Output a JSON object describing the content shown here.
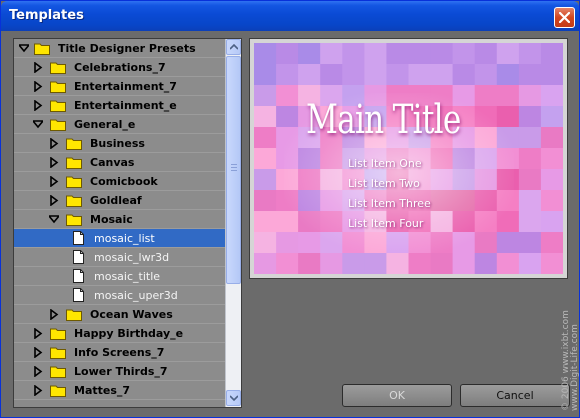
{
  "window": {
    "title": "Templates"
  },
  "colors": {
    "titlebar": "#0846c8",
    "selection": "#316ac5",
    "panel": "#6b6b6b"
  },
  "tree": {
    "rows": [
      {
        "label": "Title Designer Presets",
        "level": 0,
        "type": "folder",
        "expanded": true
      },
      {
        "label": "Celebrations_7",
        "level": 1,
        "type": "folder",
        "expanded": false
      },
      {
        "label": "Entertainment_7",
        "level": 1,
        "type": "folder",
        "expanded": false
      },
      {
        "label": "Entertainment_e",
        "level": 1,
        "type": "folder",
        "expanded": false
      },
      {
        "label": "General_e",
        "level": 1,
        "type": "folder",
        "expanded": true
      },
      {
        "label": "Business",
        "level": 2,
        "type": "folder",
        "expanded": false
      },
      {
        "label": "Canvas",
        "level": 2,
        "type": "folder",
        "expanded": false
      },
      {
        "label": "Comicbook",
        "level": 2,
        "type": "folder",
        "expanded": false
      },
      {
        "label": "Goldleaf",
        "level": 2,
        "type": "folder",
        "expanded": false
      },
      {
        "label": "Mosaic",
        "level": 2,
        "type": "folder",
        "expanded": true
      },
      {
        "label": "mosaic_list",
        "level": 3,
        "type": "file",
        "selected": true
      },
      {
        "label": "mosaic_lwr3d",
        "level": 3,
        "type": "file"
      },
      {
        "label": "mosaic_title",
        "level": 3,
        "type": "file"
      },
      {
        "label": "mosaic_uper3d",
        "level": 3,
        "type": "file"
      },
      {
        "label": "Ocean Waves",
        "level": 2,
        "type": "folder",
        "expanded": false
      },
      {
        "label": "Happy Birthday_e",
        "level": 1,
        "type": "folder",
        "expanded": false
      },
      {
        "label": "Info Screens_7",
        "level": 1,
        "type": "folder",
        "expanded": false
      },
      {
        "label": "Lower Thirds_7",
        "level": 1,
        "type": "folder",
        "expanded": false
      },
      {
        "label": "Mattes_7",
        "level": 1,
        "type": "folder",
        "expanded": false
      }
    ]
  },
  "preview": {
    "title": "Main Title",
    "items": [
      "List Item One",
      "List Item Two",
      "List Item Three",
      "List Item Four"
    ]
  },
  "buttons": {
    "ok": "OK",
    "cancel": "Cancel"
  },
  "watermark": {
    "line1": "© 2006 www.ixbt.com",
    "line2": "www.Digit-Life.com"
  }
}
